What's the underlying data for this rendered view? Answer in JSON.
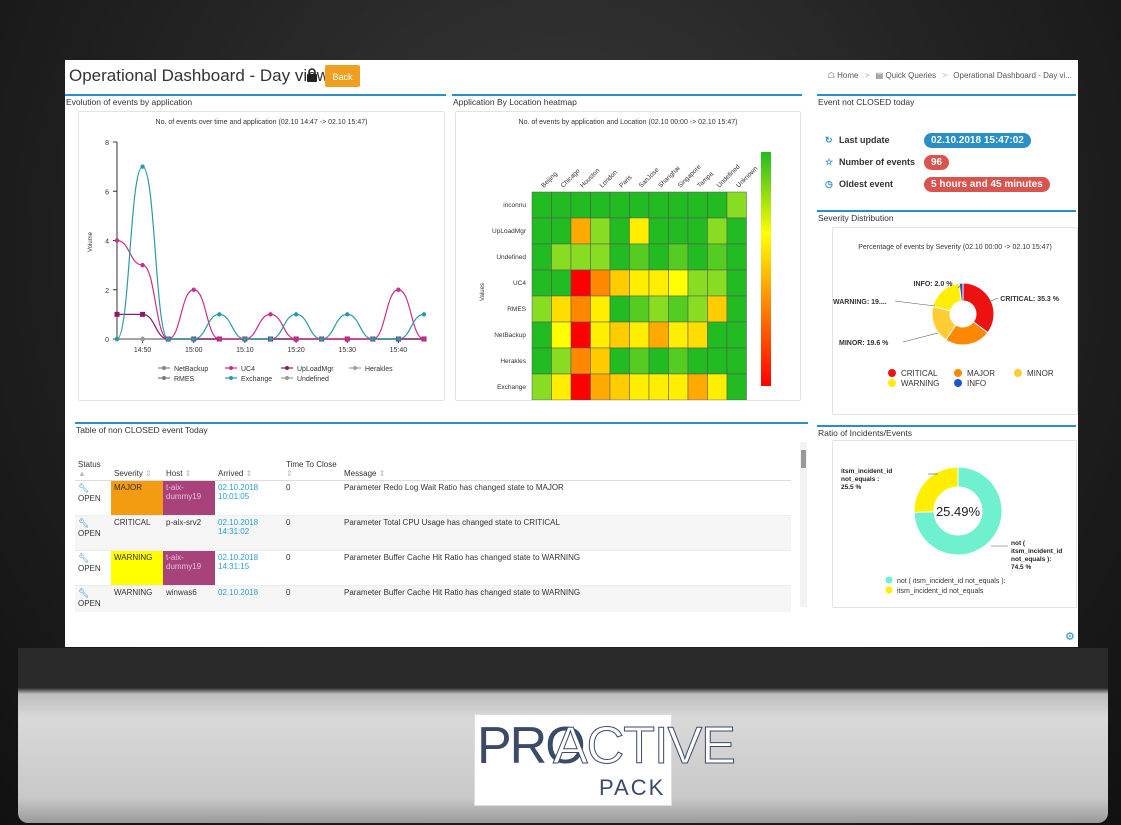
{
  "header": {
    "title": "Operational Dashboard - Day view",
    "back_label": "Back",
    "breadcrumb": [
      "Home",
      "Quick Queries",
      "Operational Dashboard - Day vi..."
    ]
  },
  "panels": {
    "evolution": "Evolution of events by application",
    "heatmap": "Application By Location heatmap",
    "not_closed": "Event not CLOSED today",
    "severity": "Severity Distribution",
    "table": "Table of non CLOSED event Today",
    "ratio": "Ratio of Incidents/Events"
  },
  "kpis": [
    {
      "icon": "refresh-icon",
      "label": "Last update",
      "value": "02.10.2018 15:47:02",
      "color": "#2a8fc6"
    },
    {
      "icon": "star-icon",
      "label": "Number of events",
      "value": "96",
      "color": "#d9534f"
    },
    {
      "icon": "clock-icon",
      "label": "Oldest event",
      "value": "5 hours and 45 minutes",
      "color": "#d9534f"
    }
  ],
  "table": {
    "headers": [
      "Status",
      "Severity",
      "Host",
      "Arrived",
      "Time To Close",
      "Message"
    ],
    "rows": [
      {
        "status": "OPEN",
        "severity": "MAJOR",
        "host": "t-aix-dummy19",
        "arrived": "02.10.2018 10:01:05",
        "ttc": "0",
        "message": "Parameter Redo Log Wait Ratio has changed state to MAJOR"
      },
      {
        "status": "OPEN",
        "severity": "CRITICAL",
        "host": "p-aix-srv2",
        "arrived": "02.10.2018 14:31:02",
        "ttc": "0",
        "message": "Parameter Total CPU Usage has changed state to CRITICAL"
      },
      {
        "status": "OPEN",
        "severity": "WARNING",
        "host": "t-aix-dummy19",
        "arrived": "02.10.2018 14:31:15",
        "ttc": "0",
        "message": "Parameter Buffer Cache Hit Ratio has changed state to WARNING"
      },
      {
        "status": "OPEN",
        "severity": "WARNING",
        "host": "winwas6",
        "arrived": "02.10.2018",
        "ttc": "0",
        "message": "Parameter Buffer Cache Hit Ratio has changed state to WARNING"
      }
    ]
  },
  "logo": {
    "pro": "PRO",
    "active": "ACTIVE",
    "pack": "PACK"
  },
  "chart_data": [
    {
      "type": "line",
      "title": "No. of events over time and application (02.10 14:47 -> 02.10 15:47)",
      "ylabel": "Volume",
      "ylim": [
        0,
        8
      ],
      "yticks": [
        0,
        2,
        4,
        6,
        8
      ],
      "xticks": [
        "14:50",
        "15:00",
        "15:10",
        "15:20",
        "15:30",
        "15:40"
      ],
      "x": [
        "14:45",
        "14:50",
        "14:55",
        "15:00",
        "15:05",
        "15:10",
        "15:15",
        "15:20",
        "15:25",
        "15:30",
        "15:35",
        "15:40",
        "15:45"
      ],
      "series": [
        {
          "name": "NetBackup",
          "color": "#888888",
          "values": [
            0,
            0,
            0,
            0,
            0,
            0,
            0,
            0,
            0,
            0,
            0,
            0,
            0
          ]
        },
        {
          "name": "UC4",
          "color": "#cc2d8c",
          "values": [
            4,
            3,
            0,
            2,
            0,
            0,
            1,
            0,
            0,
            0,
            0,
            2,
            0
          ]
        },
        {
          "name": "UpLoadMgr",
          "color": "#8b1a6b",
          "values": [
            1,
            1,
            0,
            0,
            0,
            0,
            0,
            0,
            0,
            0,
            0,
            0,
            0
          ]
        },
        {
          "name": "Herakles",
          "color": "#9aa0a8",
          "values": [
            0,
            0,
            0,
            0,
            0,
            0,
            0,
            0,
            0,
            0,
            0,
            0,
            0
          ]
        },
        {
          "name": "RMES",
          "color": "#777777",
          "values": [
            0,
            0,
            0,
            0,
            0,
            0,
            0,
            0,
            0,
            0,
            0,
            0,
            0
          ]
        },
        {
          "name": "Exchange",
          "color": "#2a9aa8",
          "values": [
            0,
            7,
            0,
            0,
            1,
            0,
            0,
            1,
            0,
            1,
            0,
            0,
            1
          ]
        },
        {
          "name": "Undefined",
          "color": "#999999",
          "values": [
            0,
            0,
            0,
            0,
            0,
            0,
            0,
            0,
            0,
            0,
            0,
            0,
            0
          ]
        }
      ]
    },
    {
      "type": "heatmap",
      "title": "No. of events by application and Location (02.10 00:00 -> 02.10 15:47)",
      "ylabel": "Values",
      "columns": [
        "Beijing",
        "Chicago",
        "Houston",
        "London",
        "Paris",
        "SanJose",
        "Shanghai",
        "Singapore",
        "Tampa",
        "Undefined",
        "Unknown"
      ],
      "rows": [
        "inconnu",
        "UpLoadMgr",
        "Undefined",
        "UC4",
        "RMES",
        "NetBackup",
        "Herakles",
        "Exchange"
      ],
      "colors": [
        [
          "#22bb22",
          "#22bb22",
          "#22bb22",
          "#22bb22",
          "#22bb22",
          "#22bb22",
          "#22bb22",
          "#22bb22",
          "#22bb22",
          "#22bb22",
          "#88dd22"
        ],
        [
          "#22bb22",
          "#22bb22",
          "#ffaa00",
          "#88dd22",
          "#22bb22",
          "#ffee00",
          "#22bb22",
          "#22bb22",
          "#22bb22",
          "#88dd22",
          "#22bb22"
        ],
        [
          "#22bb22",
          "#88dd22",
          "#88dd22",
          "#88dd22",
          "#22bb22",
          "#55cc22",
          "#22bb22",
          "#55cc22",
          "#22bb22",
          "#55cc22",
          "#22bb22"
        ],
        [
          "#22bb22",
          "#22bb22",
          "#ff0000",
          "#ff8800",
          "#ffcc00",
          "#ffee00",
          "#ffee00",
          "#ffff00",
          "#88dd22",
          "#88dd22",
          "#22bb22"
        ],
        [
          "#88dd22",
          "#ffdd00",
          "#ff8800",
          "#ffee00",
          "#22bb22",
          "#55cc22",
          "#88dd22",
          "#55cc22",
          "#88dd22",
          "#ffcc00",
          "#22bb22"
        ],
        [
          "#22bb22",
          "#ffff00",
          "#ff0000",
          "#ffee00",
          "#ffcc00",
          "#ffee00",
          "#ffaa00",
          "#ffee00",
          "#ffdd00",
          "#22bb22",
          "#22bb22"
        ],
        [
          "#22bb22",
          "#88dd22",
          "#ff8800",
          "#ffcc00",
          "#22bb22",
          "#55cc22",
          "#22bb22",
          "#55cc22",
          "#22bb22",
          "#22bb22",
          "#22bb22"
        ],
        [
          "#88dd22",
          "#ffee00",
          "#ff0000",
          "#ffaa00",
          "#ffcc00",
          "#ffee00",
          "#ffee00",
          "#ffee00",
          "#ffaa00",
          "#ffee00",
          "#22bb22"
        ]
      ]
    },
    {
      "type": "pie",
      "title": "Percentage of events by Severity (02.10 00:00 -> 02.10 15:47)",
      "slices": [
        {
          "label": "CRITICAL",
          "value": 35.3,
          "display": "CRITICAL: 35.3 %",
          "color": "#ee1111"
        },
        {
          "label": "MAJOR",
          "value": 24.0,
          "display": "",
          "color": "#ff8800"
        },
        {
          "label": "MINOR",
          "value": 19.6,
          "display": "MINOR: 19.6 %",
          "color": "#ffcc33"
        },
        {
          "label": "WARNING",
          "value": 19.1,
          "display": "WARNING: 19....",
          "color": "#ffee00"
        },
        {
          "label": "INFO",
          "value": 2.0,
          "display": "INFO: 2.0 %",
          "color": "#2255cc"
        }
      ]
    },
    {
      "type": "pie",
      "title": "",
      "center_label": "25.49%",
      "slices": [
        {
          "label": "not ( itsm_incident_id not_equals ):",
          "value": 74.5,
          "display": "not ( itsm_incident_id not_equals ): 74.5 %",
          "color": "#6ff0cf"
        },
        {
          "label": "itsm_incident_id not_equals",
          "value": 25.5,
          "display": "itsm_incident_id not_equals : 25.5 %",
          "color": "#ffee00"
        }
      ]
    }
  ]
}
